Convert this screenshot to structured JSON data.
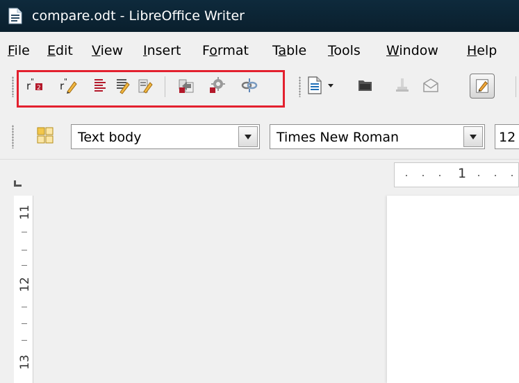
{
  "window": {
    "title": "compare.odt - LibreOffice Writer"
  },
  "menubar": {
    "items": [
      {
        "id": "file",
        "accel": "F",
        "rest": "ile"
      },
      {
        "id": "edit",
        "accel": "E",
        "rest": "dit"
      },
      {
        "id": "view",
        "accel": "V",
        "rest": "iew"
      },
      {
        "id": "insert",
        "accel": "I",
        "rest": "nsert"
      },
      {
        "id": "format",
        "pre": "F",
        "accel": "o",
        "rest": "rmat"
      },
      {
        "id": "table",
        "pre": "T",
        "accel": "a",
        "rest": "ble"
      },
      {
        "id": "tools",
        "accel": "T",
        "rest": "ools"
      },
      {
        "id": "window",
        "accel": "W",
        "rest": "indow"
      },
      {
        "id": "help",
        "accel": "H",
        "rest": "elp"
      }
    ]
  },
  "format_toolbar": {
    "paragraph_style": "Text body",
    "font_name": "Times New Roman",
    "font_size": "12"
  },
  "ruler": {
    "horizontal_label": "1",
    "vertical_labels": [
      "11",
      "12",
      "13"
    ]
  },
  "colors": {
    "highlight": "#e3202e",
    "titlebar": "#0e2a3c"
  }
}
